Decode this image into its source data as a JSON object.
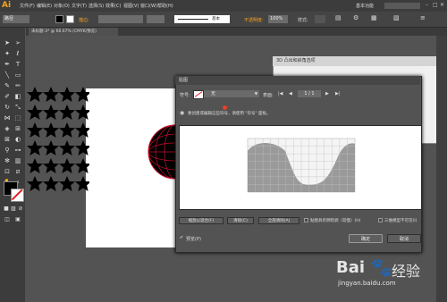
{
  "app": {
    "logo": "Ai"
  },
  "menu": [
    "文件(F)",
    "编辑(E)",
    "对象(O)",
    "文字(T)",
    "选择(S)",
    "效果(C)",
    "视图(V)",
    "窗口(W)",
    "帮助(H)"
  ],
  "topright": {
    "label": "基本功能",
    "search": ""
  },
  "controlbar": {
    "path_label": "路径",
    "stroke_label": "描边:",
    "stroke_style": "基本",
    "opacity_label": "不透明度:",
    "opacity_value": "100%",
    "style_label": "样式:"
  },
  "document_tab": "未标题-3* @ 66.67% (CMYK/预览)",
  "panel3d": {
    "title": "3D 凸出和斜角选项"
  },
  "dialog": {
    "title": "贴图",
    "symbol_label": "符号:",
    "symbol_value": "无",
    "surface_label": "表面:",
    "surface_value": "1 / 1",
    "info_text": "要创建或编辑这些符号，请使用 \"符号\" 面板。",
    "buttons": {
      "fit": "缩放以适合(F)",
      "clear": "清除(C)",
      "clear_all": "全部清除(A)"
    },
    "shade_label": "贴图具有明暗调（较慢）(H)",
    "invisible_label": "三维模型不可见(I)",
    "preview_label": "预览(P)",
    "ok": "确定",
    "cancel": "取消"
  },
  "watermark": {
    "brand": "Bai",
    "brand2": "经验",
    "url": "jingyan.baidu.com"
  },
  "colors": {
    "accent": "#f7a020",
    "dialog_bg": "#535353",
    "grid_gray": "#9a9a9a",
    "sphere_red": "#c8102e"
  }
}
